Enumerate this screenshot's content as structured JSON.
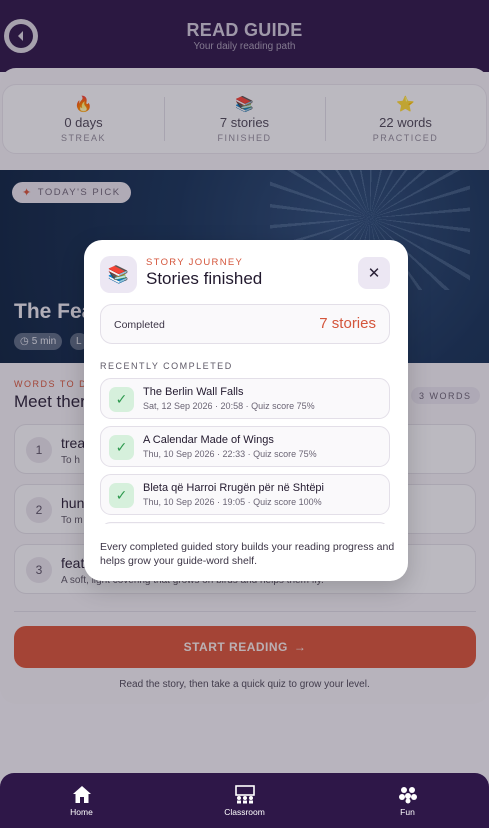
{
  "header": {
    "title": "READ GUIDE",
    "subtitle": "Your daily reading path",
    "back_icon": "back-arrow-icon"
  },
  "stats": [
    {
      "icon": "fire-icon",
      "emoji": "🔥",
      "value": "0 days",
      "label": "STREAK"
    },
    {
      "icon": "books-icon",
      "emoji": "📚",
      "value": "7 stories",
      "label": "FINISHED"
    },
    {
      "icon": "star-icon",
      "emoji": "⭐",
      "value": "22 words",
      "label": "PRACTICED"
    }
  ],
  "hero": {
    "badge": "TODAY'S PICK",
    "title": "The Fea",
    "chips": [
      "5 min",
      "L"
    ]
  },
  "words": {
    "label": "WORDS TO D",
    "heading": "Meet ther",
    "count": "3 WORDS",
    "items": [
      {
        "num": "1",
        "term": "trea",
        "def": "To h"
      },
      {
        "num": "2",
        "term": "hun",
        "def": "To m"
      },
      {
        "num": "3",
        "term": "feat",
        "def": "A soft, light covering that grows on birds and helps them fly."
      }
    ]
  },
  "start_button": {
    "label": "START READING",
    "arrow": "→"
  },
  "hint": "Read the story, then take a quick quiz to grow your level.",
  "modal": {
    "icon": "books-icon",
    "kicker": "STORY JOURNEY",
    "title": "Stories finished",
    "close_label": "✕",
    "completed_label": "Completed",
    "completed_value": "7 stories",
    "section": "RECENTLY COMPLETED",
    "stories": [
      {
        "title": "The Berlin Wall Falls",
        "meta": "Sat, 12 Sep 2026 · 20:58 · Quiz score 75%"
      },
      {
        "title": "A Calendar Made of Wings",
        "meta": "Thu, 10 Sep 2026 · 22:33 · Quiz score 75%"
      },
      {
        "title": "Bleta që Harroi Rrugën për në Shtëpi",
        "meta": "Thu, 10 Sep 2026 · 19:05 · Quiz score 100%"
      }
    ],
    "footer": "Every completed guided story builds your reading progress and helps grow your guide-word shelf."
  },
  "nav": [
    {
      "label": "Home",
      "icon": "home-icon"
    },
    {
      "label": "Classroom",
      "icon": "classroom-icon"
    },
    {
      "label": "Fun",
      "icon": "fun-icon"
    }
  ],
  "colors": {
    "brand": "#2e1748",
    "accent": "#d6543a",
    "success": "#2f9a4f"
  }
}
